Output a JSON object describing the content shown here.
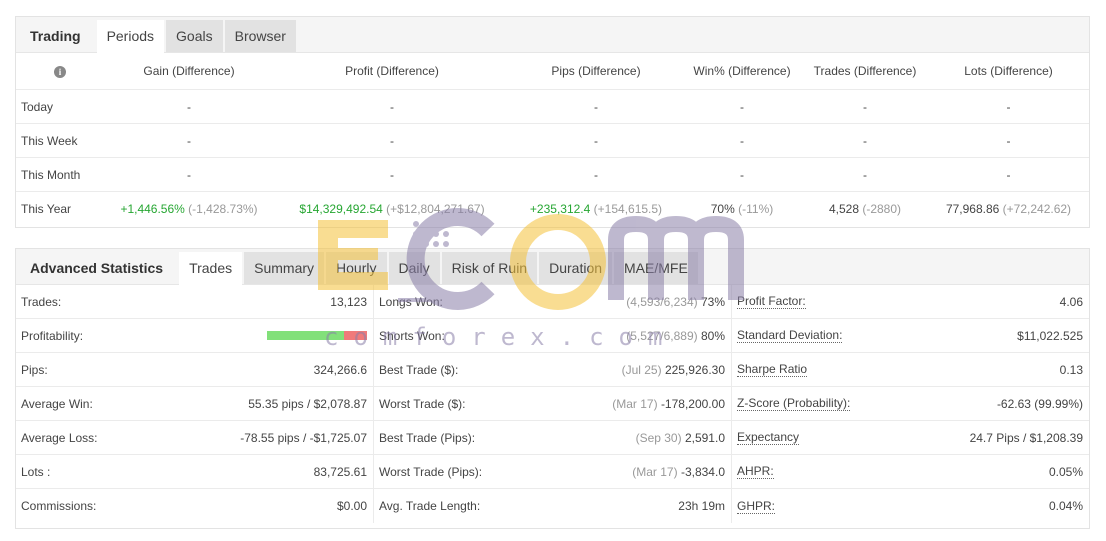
{
  "periods_panel": {
    "tabs": [
      {
        "label": "Trading",
        "kind": "title"
      },
      {
        "label": "Periods",
        "kind": "active"
      },
      {
        "label": "Goals",
        "kind": "grey"
      },
      {
        "label": "Browser",
        "kind": "grey"
      }
    ],
    "headers": [
      "Gain (Difference)",
      "Profit (Difference)",
      "Pips (Difference)",
      "Win% (Difference)",
      "Trades (Difference)",
      "Lots (Difference)"
    ],
    "rows": [
      {
        "label": "Today",
        "cells": [
          {
            "v": "-"
          },
          {
            "v": "-"
          },
          {
            "v": "-"
          },
          {
            "v": "-"
          },
          {
            "v": "-"
          },
          {
            "v": "-"
          }
        ]
      },
      {
        "label": "This Week",
        "cells": [
          {
            "v": "-"
          },
          {
            "v": "-"
          },
          {
            "v": "-"
          },
          {
            "v": "-"
          },
          {
            "v": "-"
          },
          {
            "v": "-"
          }
        ]
      },
      {
        "label": "This Month",
        "cells": [
          {
            "v": "-"
          },
          {
            "v": "-"
          },
          {
            "v": "-"
          },
          {
            "v": "-"
          },
          {
            "v": "-"
          },
          {
            "v": "-"
          }
        ]
      },
      {
        "label": "This Year",
        "cells": [
          {
            "v": "+1,446.56%",
            "d": "(-1,428.73%)",
            "pos": true
          },
          {
            "v": "$14,329,492.54",
            "d": "(+$12,804,271.67)",
            "pos": true
          },
          {
            "v": "+235,312.4",
            "d": "(+154,615.5)",
            "pos": true
          },
          {
            "v": "70%",
            "d": "(-11%)"
          },
          {
            "v": "4,528",
            "d": "(-2880)"
          },
          {
            "v": "77,968.86",
            "d": "(+72,242.62)"
          }
        ]
      }
    ]
  },
  "stats_panel": {
    "title": "Advanced Statistics",
    "tabs": [
      "Trades",
      "Summary",
      "Hourly",
      "Daily",
      "Risk of Ruin",
      "Duration",
      "MAE/MFE"
    ],
    "col1": [
      {
        "label": "Trades:",
        "value": "13,123"
      },
      {
        "label": "Profitability:",
        "value": ""
      },
      {
        "label": "Pips:",
        "value": "324,266.6"
      },
      {
        "label": "Average Win:",
        "value": "55.35 pips / $2,078.87"
      },
      {
        "label": "Average Loss:",
        "value": "-78.55 pips / -$1,725.07"
      },
      {
        "label": "Lots :",
        "value": "83,725.61"
      },
      {
        "label": "Commissions:",
        "value": "$0.00"
      }
    ],
    "profitability": {
      "win_fraction": 0.77
    },
    "col2": [
      {
        "label": "Longs Won:",
        "sub": "(4,593/6,234)",
        "value": "73%"
      },
      {
        "label": "Shorts Won:",
        "sub": "(5,527/6,889)",
        "value": "80%"
      },
      {
        "label": "Best Trade ($):",
        "sub": "(Jul 25)",
        "value": "225,926.30"
      },
      {
        "label": "Worst Trade ($):",
        "sub": "(Mar 17)",
        "value": "-178,200.00"
      },
      {
        "label": "Best Trade (Pips):",
        "sub": "(Sep 30)",
        "value": "2,591.0"
      },
      {
        "label": "Worst Trade (Pips):",
        "sub": "(Mar 17)",
        "value": "-3,834.0"
      },
      {
        "label": "Avg. Trade Length:",
        "sub": "",
        "value": "23h 19m"
      }
    ],
    "col3": [
      {
        "label": "Profit Factor:",
        "value": "4.06"
      },
      {
        "label": "Standard Deviation:",
        "value": "$11,022.525"
      },
      {
        "label": "Sharpe Ratio",
        "value": "0.13"
      },
      {
        "label": "Z-Score (Probability):",
        "value": "-62.63 (99.99%)"
      },
      {
        "label": "Expectancy",
        "value": "24.7 Pips / $1,208.39"
      },
      {
        "label": "AHPR:",
        "value": "0.05%"
      },
      {
        "label": "GHPR:",
        "value": "0.04%"
      }
    ]
  },
  "watermark": {
    "text": "ecomforex.com"
  },
  "colors": {
    "positive": "#26a632",
    "bar_green": "#82e07a",
    "bar_red": "#f07a7a"
  }
}
